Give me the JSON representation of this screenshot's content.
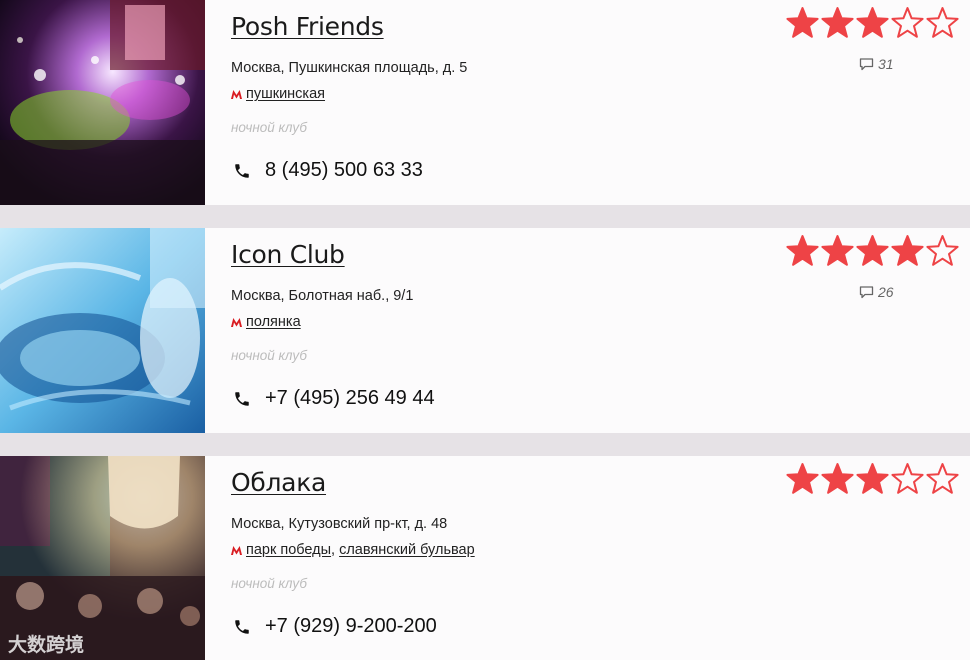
{
  "colors": {
    "star": "#ee4346",
    "metro": "#d91c22",
    "background": "#e6e2e6",
    "card": "#fcfbfc"
  },
  "listings": [
    {
      "name": "Posh Friends",
      "address": "Москва, Пушкинская площадь, д. 5",
      "metro_icon": "metro-logo-icon",
      "metro_stations": [
        "пушкинская"
      ],
      "category": "ночной клуб",
      "phone": "8 (495) 500 63 33",
      "rating": 3,
      "rating_max": 5,
      "comments": "31",
      "photo": "nightclub-dancefloor-photo"
    },
    {
      "name": "Icon Club",
      "address": "Москва, Болотная наб., 9/1",
      "metro_icon": "metro-logo-icon",
      "metro_stations": [
        "полянка"
      ],
      "category": "ночной клуб",
      "phone": "+7 (495) 256 49 44",
      "rating": 4,
      "rating_max": 5,
      "comments": "26",
      "photo": "blue-lounge-interior-photo"
    },
    {
      "name": "Облака",
      "address": "Москва, Кутузовский пр-кт, д. 48",
      "metro_icon": "metro-logo-icon",
      "metro_stations": [
        "парк победы",
        "славянский бульвар"
      ],
      "category": "ночной клуб",
      "phone": "+7 (929) 9-200-200",
      "rating": 3,
      "rating_max": 5,
      "comments": "",
      "photo": "club-crowd-chandelier-photo"
    }
  ],
  "watermark": "大数跨境"
}
